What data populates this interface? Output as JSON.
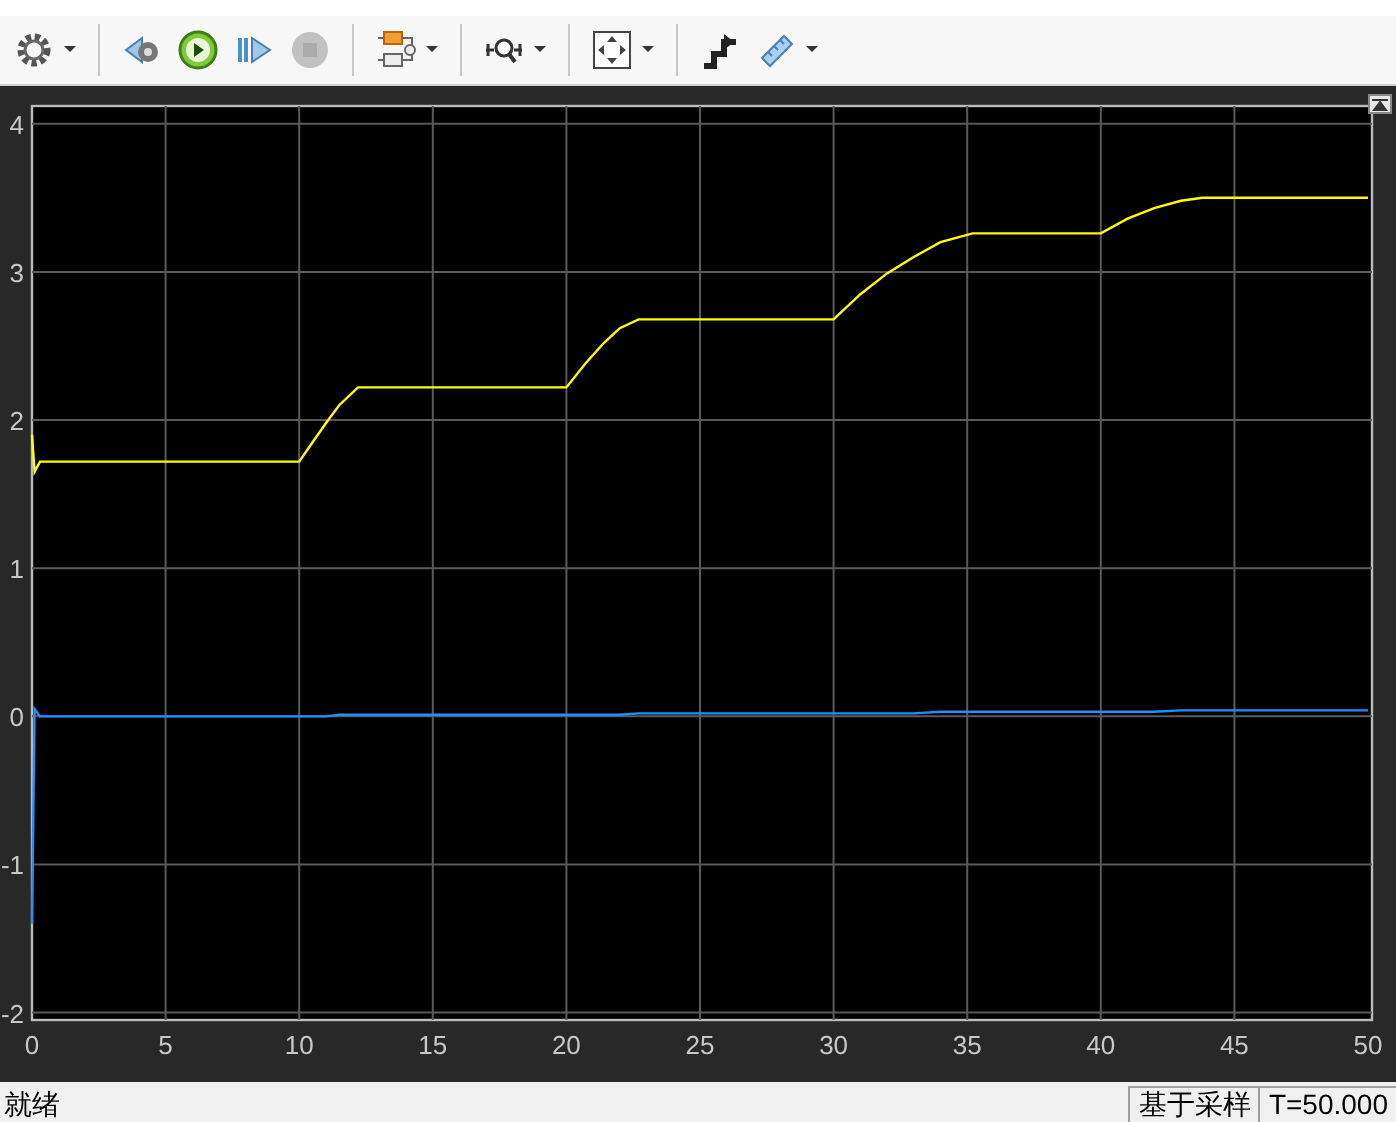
{
  "toolbar": {
    "buttons": [
      {
        "kind": "gear",
        "dropdown": true
      },
      {
        "kind": "sep"
      },
      {
        "kind": "stepback",
        "dropdown": false
      },
      {
        "kind": "run",
        "dropdown": false
      },
      {
        "kind": "stepfwd",
        "dropdown": false
      },
      {
        "kind": "stop",
        "dropdown": false,
        "disabled": true
      },
      {
        "kind": "sep"
      },
      {
        "kind": "blocks",
        "dropdown": true
      },
      {
        "kind": "sep"
      },
      {
        "kind": "zoomx",
        "dropdown": true
      },
      {
        "kind": "sep"
      },
      {
        "kind": "fit",
        "dropdown": true
      },
      {
        "kind": "sep"
      },
      {
        "kind": "steps",
        "dropdown": false
      },
      {
        "kind": "ruler",
        "dropdown": true
      }
    ]
  },
  "scope": {
    "chart_data": {
      "type": "line",
      "x": [
        0,
        0.1,
        0.3,
        10,
        10.5,
        11,
        11.5,
        12.2,
        20,
        20.7,
        21.4,
        22,
        22.7,
        30,
        31,
        32,
        33,
        34,
        35.2,
        40,
        41,
        42,
        43,
        43.8,
        50
      ],
      "series": [
        {
          "color": "#ffff00",
          "values": [
            1.9,
            1.65,
            1.72,
            1.72,
            1.85,
            1.98,
            2.1,
            2.22,
            2.22,
            2.38,
            2.52,
            2.62,
            2.68,
            2.68,
            2.85,
            2.99,
            3.1,
            3.2,
            3.26,
            3.26,
            3.36,
            3.43,
            3.48,
            3.5,
            3.5
          ]
        },
        {
          "color": "#1e90ff",
          "values": [
            -1.4,
            0.05,
            0.0,
            0.0,
            0.0,
            0.0,
            0.01,
            0.01,
            0.01,
            0.01,
            0.01,
            0.01,
            0.02,
            0.02,
            0.02,
            0.02,
            0.02,
            0.03,
            0.03,
            0.03,
            0.03,
            0.03,
            0.04,
            0.04,
            0.04
          ]
        }
      ],
      "grid": true,
      "xlim": [
        0,
        50
      ],
      "ylim": [
        -2.05,
        4.12
      ],
      "xticks": [
        0,
        5,
        10,
        15,
        20,
        25,
        30,
        35,
        40,
        45,
        50
      ],
      "yticks": [
        -2,
        -1,
        0,
        1,
        2,
        3,
        4
      ]
    }
  },
  "status_bar": {
    "left": "就绪",
    "cells": [
      "基于采样",
      "T=50.000"
    ]
  }
}
